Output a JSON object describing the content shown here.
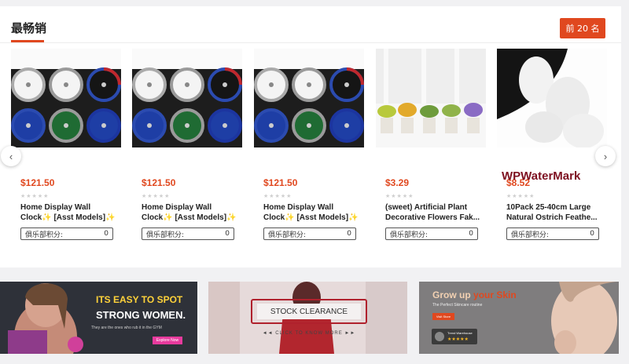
{
  "section": {
    "title": "最畅销",
    "top_button": "前 20 名"
  },
  "products": [
    {
      "price": "$121.50",
      "name": "Home Display Wall Clock✨ [Asst Models]✨",
      "points_label": "俱乐部积分:",
      "points_value": "0",
      "image": "clocks"
    },
    {
      "price": "$121.50",
      "name": "Home Display Wall Clock✨ [Asst Models]✨",
      "points_label": "俱乐部积分:",
      "points_value": "0",
      "image": "clocks"
    },
    {
      "price": "$121.50",
      "name": "Home Display Wall Clock✨ [Asst Models]✨",
      "points_label": "俱乐部积分:",
      "points_value": "0",
      "image": "clocks"
    },
    {
      "price": "$3.29",
      "name": "(sweet) Artificial Plant Decorative Flowers Fak...",
      "points_label": "俱乐部积分:",
      "points_value": "0",
      "image": "plants"
    },
    {
      "price": "$8.52",
      "name": "10Pack 25-40cm Large Natural Ostrich Feathe...",
      "points_label": "俱乐部积分:",
      "points_value": "0",
      "image": "feathers"
    }
  ],
  "stars": "★★★★★",
  "watermark": "WPWaterMark",
  "carousel": {
    "prev": "‹",
    "next": "›"
  },
  "banners": [
    {
      "line1": "ITS EASY TO SPOT",
      "line2": "STRONG WOMEN.",
      "sub": "They are the ones who rub it in the GYM",
      "button": "Explore Now"
    },
    {
      "label": "STOCK CLEARANCE",
      "sub": "◄◄ CLICK TO KNOW MORE ►►"
    },
    {
      "title1": "Grow up",
      "title2": "your Skin",
      "sub": "The Perfect Skincare routine",
      "button": "Visit Store",
      "badge_title": "Trend Warehouse",
      "badge_stars": "★★★★★"
    }
  ],
  "colors": {
    "accent": "#e0481f",
    "watermark": "#7d1020"
  }
}
